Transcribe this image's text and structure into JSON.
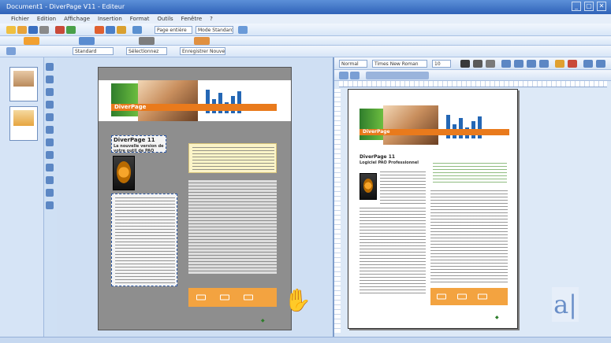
{
  "window": {
    "title": "Document1 - DiverPage V11 - Editeur",
    "controls": [
      "_",
      "▢",
      "✕"
    ]
  },
  "menu": [
    "Fichier",
    "Edition",
    "Affichage",
    "Insertion",
    "Format",
    "Outils",
    "Fenêtre",
    "?"
  ],
  "toolbar": {
    "zoom_value": "Page entière",
    "mode_value": "Mode Standard",
    "font_left": "Standard",
    "font_mid": "Sélectionnez",
    "style_value": "Enregistrer Nouveau"
  },
  "left_page": {
    "masthead": "DiverPage",
    "headline": "DiverPage 11",
    "subhead": "La nouvelle version de votre outil de PAO"
  },
  "right_panel": {
    "style_combo": "Normal",
    "font_combo": "Times New Roman",
    "size_combo": "10",
    "masthead": "DiverPage",
    "headline": "DiverPage 11",
    "subhead": "Logiciel PAO Professionnel"
  },
  "colors": {
    "accent": "#e97a1c",
    "brand_green": "#2f7d2c",
    "title_bar": "#2f62b8"
  },
  "icons": [
    "new-icon",
    "open-icon",
    "save-icon",
    "print-icon",
    "undo-icon",
    "redo-icon",
    "zoom-icon",
    "text-tool-icon",
    "select-tool-icon",
    "image-tool-icon",
    "letter-a-icon"
  ]
}
